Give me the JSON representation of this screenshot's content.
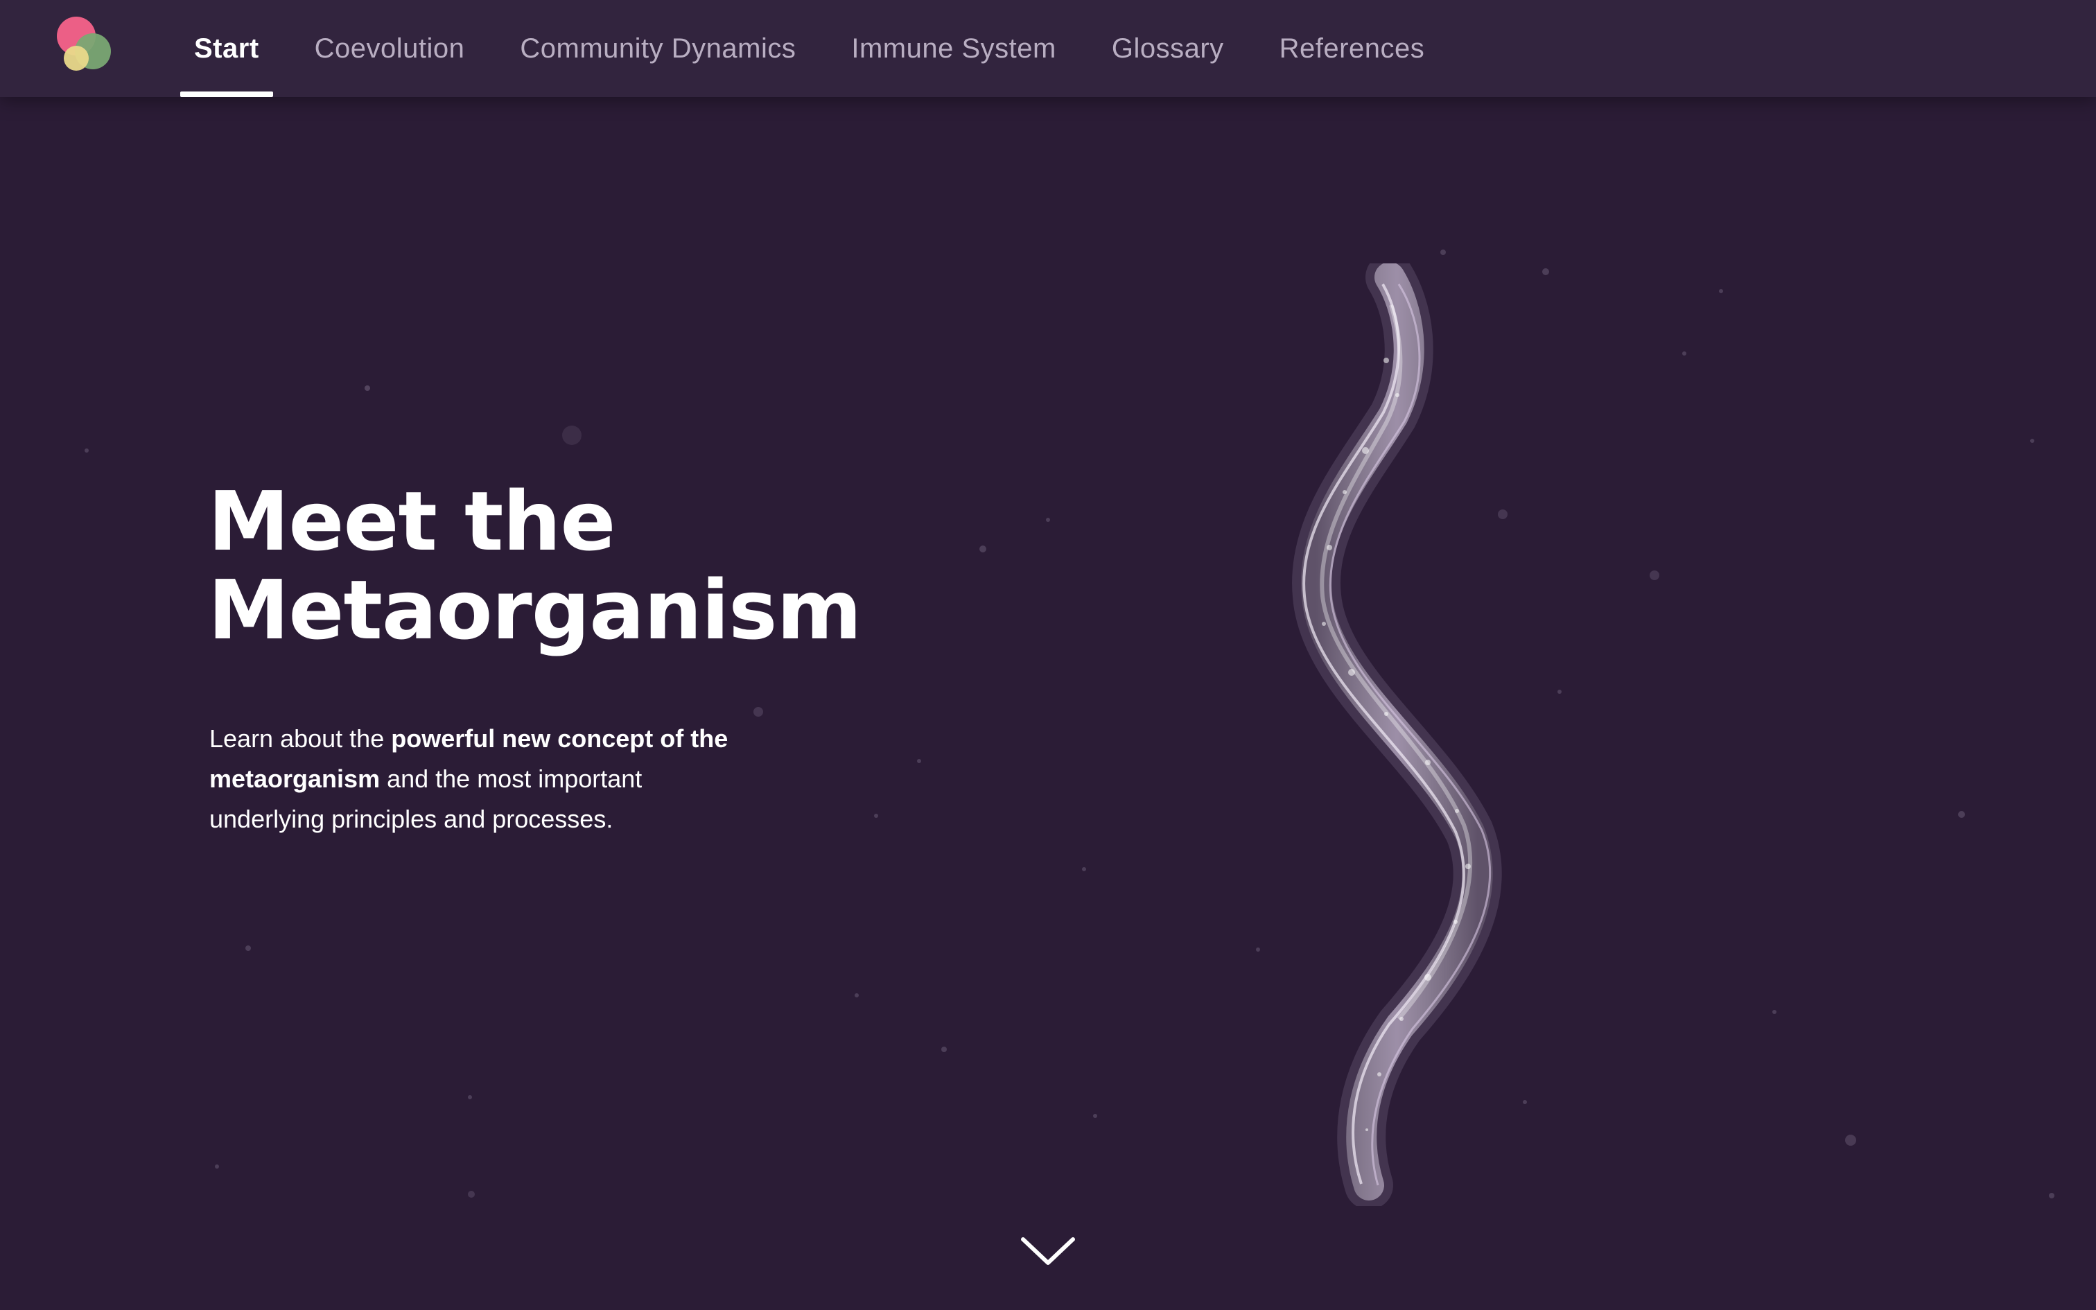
{
  "nav": {
    "logo_icon": "metaorganism-circles-logo",
    "tabs": [
      {
        "label": "Start",
        "active": true
      },
      {
        "label": "Coevolution",
        "active": false
      },
      {
        "label": "Community Dynamics",
        "active": false
      },
      {
        "label": "Immune System",
        "active": false
      },
      {
        "label": "Glossary",
        "active": false
      },
      {
        "label": "References",
        "active": false
      }
    ]
  },
  "hero": {
    "title_line1": "Meet the",
    "title_line2": "Metaorganism",
    "desc_part1": "Learn about the ",
    "desc_bold1": "powerful new concept of the metaorganism",
    "desc_part2": " and the most important underlying principles and processes.",
    "illustration_icon": "worm-illustration"
  },
  "scroll": {
    "icon": "chevron-down-icon"
  },
  "colors": {
    "background": "#2b1c36",
    "navbar": "#32243e",
    "text": "#ffffff",
    "nav_inactive": "#b9aec2",
    "logo_pink": "#ec5f86",
    "logo_green": "#7aa873",
    "logo_yellow": "#e9d98a"
  }
}
